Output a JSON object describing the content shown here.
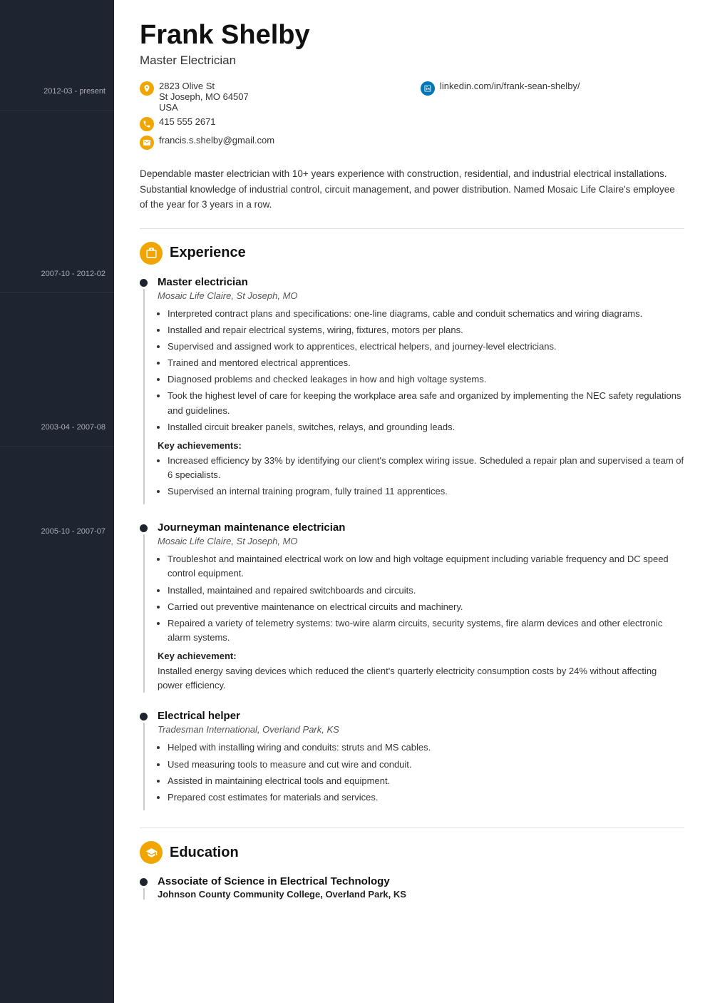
{
  "sidebar": {
    "dates": [
      {
        "id": "exp1-date",
        "text": "2012-03 - present"
      },
      {
        "id": "exp2-date",
        "text": "2007-10 - 2012-02"
      },
      {
        "id": "exp3-date",
        "text": "2003-04 - 2007-08"
      },
      {
        "id": "edu1-date",
        "text": "2005-10 - 2007-07"
      }
    ]
  },
  "header": {
    "name": "Frank Shelby",
    "title": "Master Electrician"
  },
  "contact": {
    "address_line1": "2823 Olive St",
    "address_line2": "St Joseph, MO 64507",
    "address_line3": "USA",
    "phone": "415 555 2671",
    "email": "francis.s.shelby@gmail.com",
    "linkedin": "linkedin.com/in/frank-sean-shelby/"
  },
  "summary": "Dependable master electrician with 10+ years experience with construction, residential, and industrial electrical installations. Substantial knowledge of industrial control, circuit management, and power distribution. Named Mosaic Life Claire's employee of the year for 3 years in a row.",
  "sections": {
    "experience_label": "Experience",
    "education_label": "Education"
  },
  "experience": [
    {
      "title": "Master electrician",
      "company": "Mosaic Life Claire, St Joseph, MO",
      "bullets": [
        "Interpreted contract plans and specifications: one-line diagrams, cable and conduit schematics and wiring diagrams.",
        "Installed and repair electrical systems, wiring, fixtures, motors per plans.",
        "Supervised and assigned work to apprentices, electrical helpers, and journey-level electricians.",
        "Trained and mentored electrical apprentices.",
        "Diagnosed problems and checked leakages in how and high voltage systems.",
        "Took the highest level of care for keeping the workplace area safe and organized by implementing the NEC safety regulations and guidelines.",
        "Installed circuit breaker panels, switches, relays, and grounding leads."
      ],
      "achievements_label": "Key achievements:",
      "achievements": [
        "Increased efficiency by 33% by identifying our client's complex wiring issue. Scheduled a repair plan and supervised a team of 6 specialists.",
        "Supervised an internal training program, fully trained 11 apprentices."
      ]
    },
    {
      "title": "Journeyman maintenance electrician",
      "company": "Mosaic Life Claire, St Joseph, MO",
      "bullets": [
        "Troubleshot and maintained electrical work on low and high voltage equipment including variable frequency and DC speed control equipment.",
        "Installed, maintained and repaired switchboards and circuits.",
        "Carried out preventive maintenance on electrical circuits and machinery.",
        "Repaired a variety of telemetry systems: two-wire alarm circuits, security systems, fire alarm devices and other electronic alarm systems."
      ],
      "achievements_label": "Key achievement:",
      "achievements_text": "Installed energy saving devices which reduced the client's quarterly electricity consumption costs by 24% without affecting power efficiency."
    },
    {
      "title": "Electrical helper",
      "company": "Tradesman International, Overland Park, KS",
      "bullets": [
        "Helped with installing wiring and conduits: struts and MS cables.",
        "Used measuring tools to measure and cut wire and conduit.",
        "Assisted in maintaining electrical tools and equipment.",
        "Prepared cost estimates for materials and services."
      ]
    }
  ],
  "education": [
    {
      "degree": "Associate of Science in Electrical Technology",
      "school": "Johnson County Community College, Overland Park, KS"
    }
  ]
}
